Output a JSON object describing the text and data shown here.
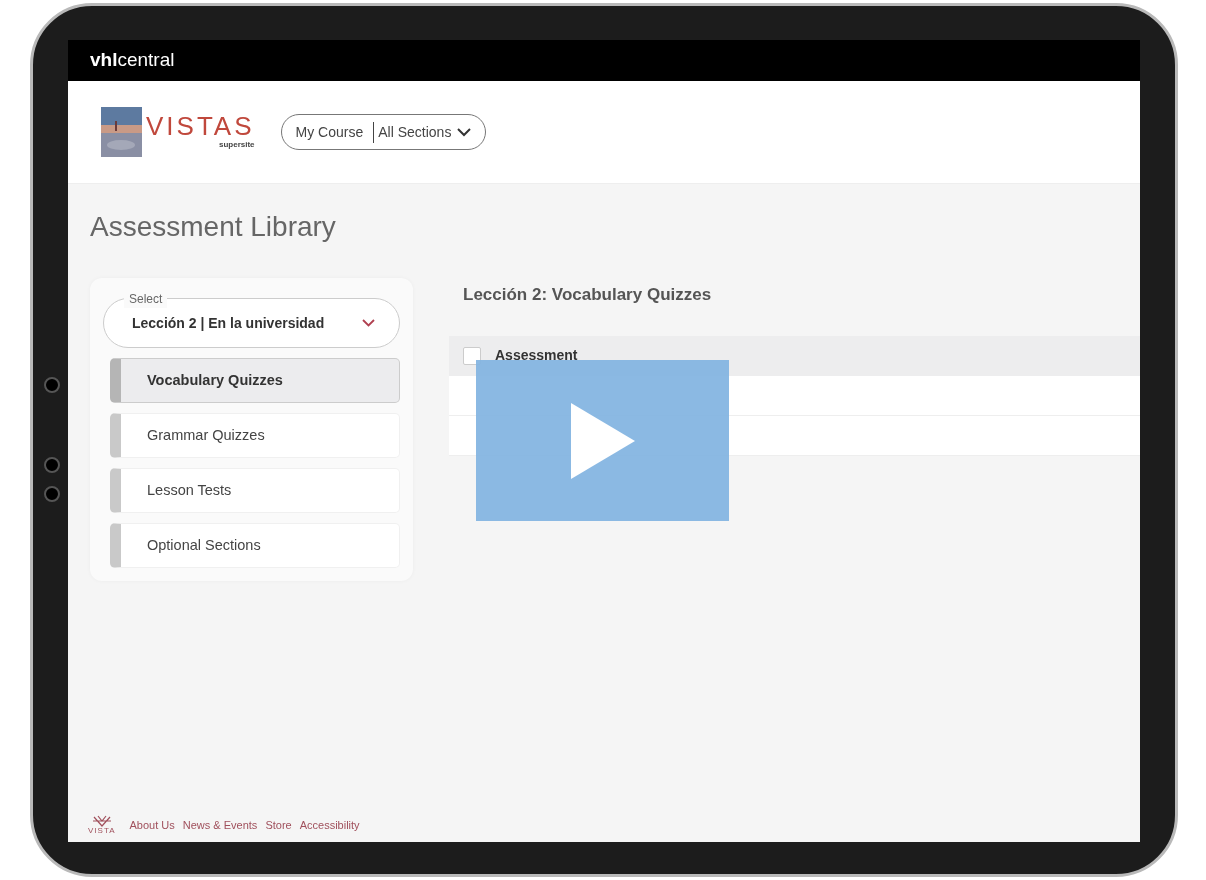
{
  "top_bar": {
    "logo": "**vhl**central"
  },
  "header": {
    "brand": "VISTAS",
    "brand_sub": "supersite",
    "course_selector": {
      "course": "My Course",
      "section": "All Sections"
    }
  },
  "page_title": "Assessment Library",
  "sidebar": {
    "select": {
      "label": "Select",
      "value": "Lección 2 | En la universidad"
    },
    "items": [
      {
        "label": "Vocabulary Quizzes",
        "selected": true
      },
      {
        "label": "Grammar Quizzes",
        "selected": false
      },
      {
        "label": "Lesson Tests",
        "selected": false
      },
      {
        "label": "Optional Sections",
        "selected": false
      }
    ]
  },
  "content": {
    "heading": "Lección 2: Vocabulary Quizzes",
    "table": {
      "columns": [
        "Assessment"
      ],
      "header_checked": false
    }
  },
  "footer": {
    "logo_text": "VISTA",
    "links": [
      "About Us",
      "News & Events",
      "Store",
      "Accessibility"
    ]
  }
}
